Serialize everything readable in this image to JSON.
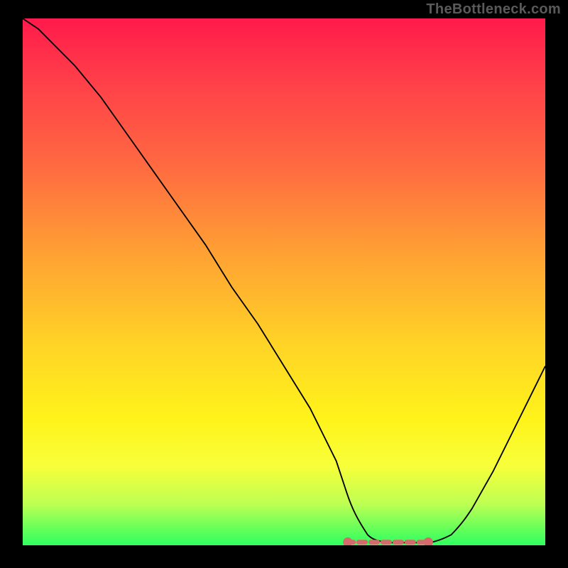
{
  "watermark": "TheBottleneck.com",
  "chart_data": {
    "type": "line",
    "title": "",
    "xlabel": "",
    "ylabel": "",
    "xlim": [
      0,
      100
    ],
    "ylim": [
      0,
      100
    ],
    "legend": false,
    "grid": false,
    "background": "rainbow-gradient (red top → green bottom)",
    "series": [
      {
        "name": "bottleneck-curve",
        "color": "#000000",
        "x": [
          0,
          3,
          6,
          10,
          15,
          20,
          25,
          30,
          35,
          40,
          45,
          50,
          55,
          60,
          62,
          64,
          66,
          68,
          70,
          74,
          78,
          82,
          86,
          90,
          94,
          98,
          100
        ],
        "values": [
          100,
          98,
          95,
          91,
          85,
          78,
          71,
          64,
          57,
          49,
          42,
          34,
          26,
          16,
          10,
          5,
          2,
          1,
          0.5,
          0.5,
          0.5,
          2,
          7,
          14,
          22,
          30,
          34
        ]
      }
    ],
    "annotations": [
      {
        "name": "optimum-zone",
        "shape": "flat-base-marker",
        "x_range": [
          62,
          78
        ],
        "y": 0.6,
        "color": "#d46a6a"
      }
    ]
  },
  "colors": {
    "frame": "#000000",
    "watermark": "#5a5a5a",
    "curve": "#000000",
    "marker": "#d46a6a"
  }
}
